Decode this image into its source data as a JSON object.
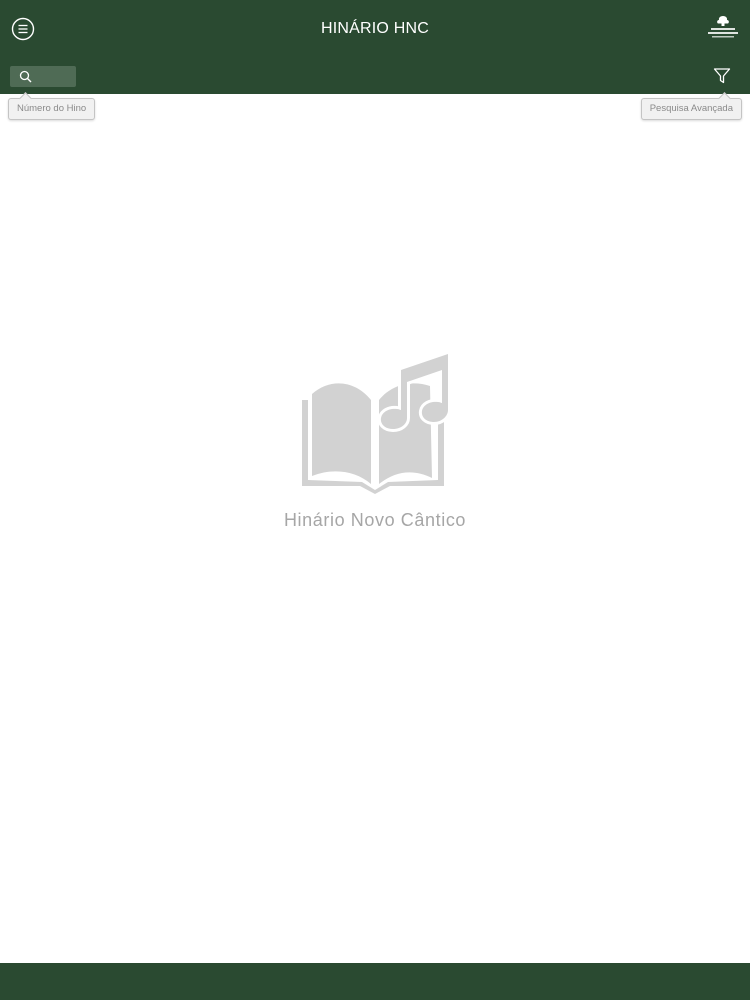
{
  "header": {
    "title": "HINÁRIO HNC",
    "menu_icon": "hamburger-circle-icon",
    "logo_icon": "church-logo-icon",
    "filter_icon": "funnel-icon",
    "search_icon": "magnifier-icon",
    "search": {
      "value": "",
      "placeholder": ""
    }
  },
  "tooltips": {
    "hymn_number": "Número do Hino",
    "advanced_search": "Pesquisa Avançada"
  },
  "main": {
    "empty_state_icon": "book-music-icon",
    "empty_state_label": "Hinário Novo Cântico"
  },
  "colors": {
    "header_bg": "#2a4a31",
    "search_bg": "#4f6b55",
    "placeholder_gray": "#a6a6a6"
  }
}
